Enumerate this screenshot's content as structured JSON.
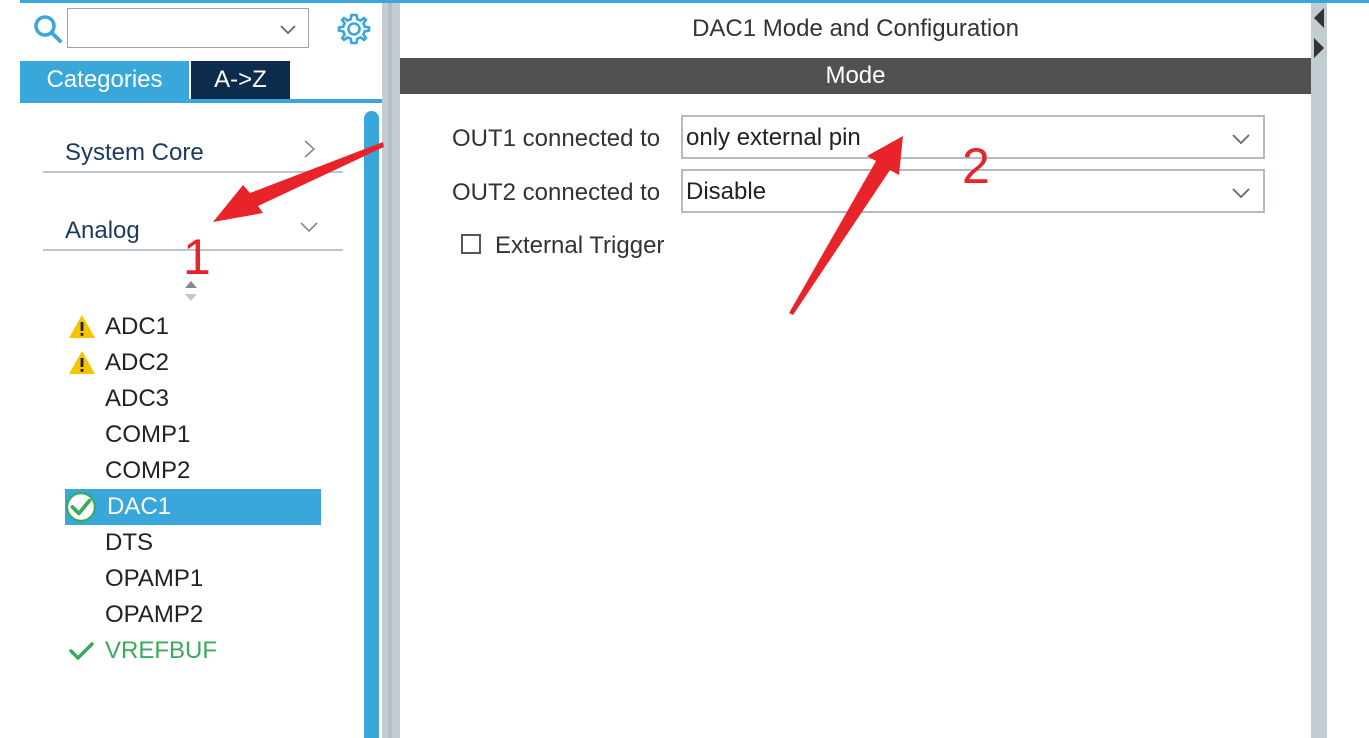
{
  "search": {
    "value": ""
  },
  "tabs": {
    "categories": "Categories",
    "az": "A->Z"
  },
  "categories": {
    "system_core": "System Core",
    "analog": "Analog"
  },
  "analog_items": [
    {
      "label": "ADC1",
      "status": "warning"
    },
    {
      "label": "ADC2",
      "status": "warning"
    },
    {
      "label": "ADC3",
      "status": "none"
    },
    {
      "label": "COMP1",
      "status": "none"
    },
    {
      "label": "COMP2",
      "status": "none"
    },
    {
      "label": "DAC1",
      "status": "selected-ok"
    },
    {
      "label": "DTS",
      "status": "none"
    },
    {
      "label": "OPAMP1",
      "status": "none"
    },
    {
      "label": "OPAMP2",
      "status": "none"
    },
    {
      "label": "VREFBUF",
      "status": "ok"
    }
  ],
  "panel": {
    "title": "DAC1 Mode and Configuration",
    "mode_header": "Mode",
    "out1_label": "OUT1 connected to",
    "out1_value": "only external pin",
    "out2_label": "OUT2 connected to",
    "out2_value": "Disable",
    "external_trigger_label": "External Trigger",
    "external_trigger_checked": false
  },
  "annotations": {
    "marker_1": "1",
    "marker_2": "2"
  },
  "colors": {
    "accent": "#3aa7db",
    "navy": "#0d2b4c",
    "mode_bar": "#4f5152",
    "warning": "#f5c400",
    "ok_green": "#3aaa5a",
    "annotation_red": "#e8232a"
  }
}
